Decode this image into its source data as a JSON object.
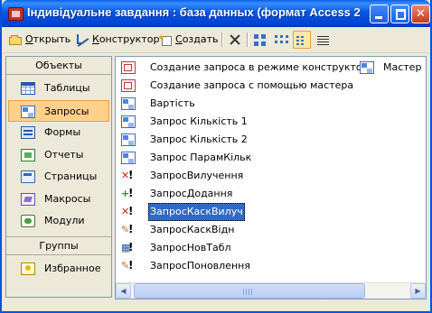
{
  "window": {
    "title": "Індивідуальне завдання : база данных (формат Access 2..."
  },
  "toolbar": {
    "open_label": "Открыть",
    "open_underline": "О",
    "constructor_label": "Конструктор",
    "constructor_underline": "К",
    "create_label": "Создать",
    "create_underline": "С",
    "delete_icon": "delete-icon",
    "view_mode_selected": "list"
  },
  "sidebar": {
    "objects_header": "Объекты",
    "items": [
      {
        "label": "Таблицы",
        "icon": "table-icon"
      },
      {
        "label": "Запросы",
        "icon": "query-icon",
        "selected": true
      },
      {
        "label": "Формы",
        "icon": "form-icon"
      },
      {
        "label": "Отчеты",
        "icon": "report-icon"
      },
      {
        "label": "Страницы",
        "icon": "page-icon"
      },
      {
        "label": "Макросы",
        "icon": "macro-icon"
      },
      {
        "label": "Модули",
        "icon": "module-icon"
      }
    ],
    "groups_header": "Группы",
    "group_items": [
      {
        "label": "Избранное",
        "icon": "favorites-icon"
      }
    ]
  },
  "list": {
    "items": [
      {
        "label": "Создание запроса в режиме конструктора",
        "icon": "design-shortcut-icon"
      },
      {
        "label": "Создание запроса с помощью мастера",
        "icon": "wizard-shortcut-icon"
      },
      {
        "label": "Вартість",
        "icon": "select-query-icon"
      },
      {
        "label": "Запрос Кількість 1",
        "icon": "select-query-icon"
      },
      {
        "label": "Запрос Кількість 2",
        "icon": "select-query-icon"
      },
      {
        "label": "Запрос ПарамКільк",
        "icon": "select-query-icon"
      },
      {
        "label": "ЗапросВилучення",
        "icon": "delete-query-icon"
      },
      {
        "label": "ЗапросДодання",
        "icon": "append-query-icon"
      },
      {
        "label": "ЗапросКаскВилуч",
        "icon": "delete-query-icon",
        "selected": true
      },
      {
        "label": "ЗапросКаскВідн",
        "icon": "update-query-icon"
      },
      {
        "label": "ЗапросНовТабл",
        "icon": "make-table-query-icon"
      },
      {
        "label": "ЗапросПоновлення",
        "icon": "update-query-icon"
      }
    ],
    "second_column_item": {
      "label": "Мастер К",
      "icon": "select-query-icon"
    }
  }
}
